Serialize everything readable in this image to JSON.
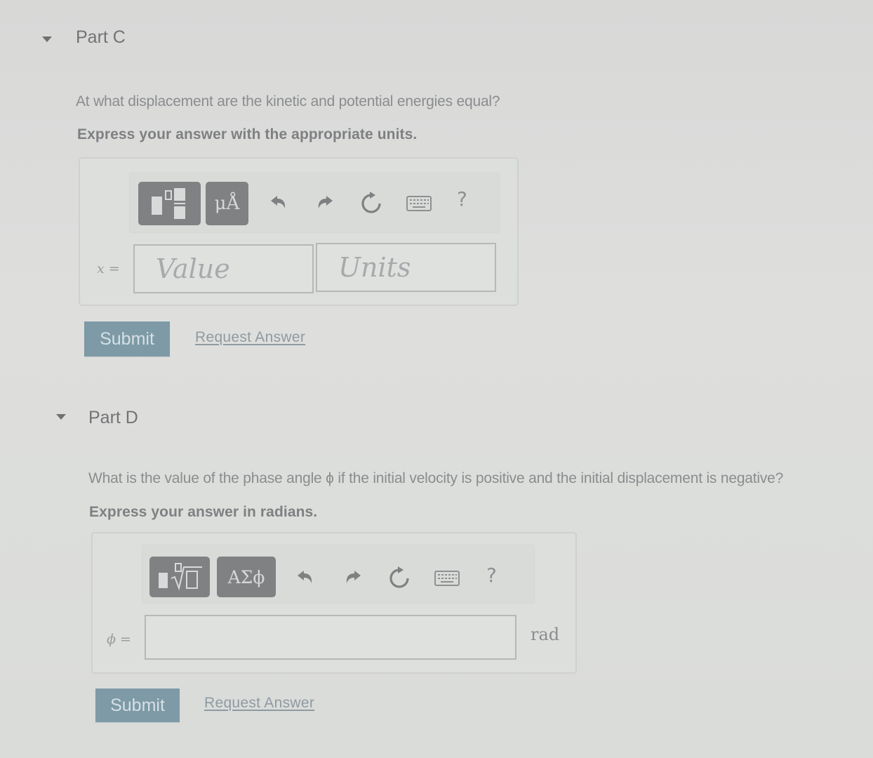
{
  "part_c": {
    "title": "Part C",
    "question": "At what displacement are the kinetic and potential energies equal?",
    "instruction": "Express your answer with the appropriate units.",
    "toolbar": {
      "template_button": "templates-icon",
      "units_button_label": "μÅ",
      "undo": "undo-icon",
      "redo": "redo-icon",
      "reset": "reset-icon",
      "keyboard": "keyboard-icon",
      "help_label": "?"
    },
    "variable_label": "x =",
    "value_placeholder": "Value",
    "units_placeholder": "Units",
    "submit_label": "Submit",
    "request_answer_label": "Request Answer"
  },
  "part_d": {
    "title": "Part D",
    "question": "What is the value of the phase angle ϕ if the initial velocity is positive and the initial displacement is negative?",
    "instruction": "Express your answer in radians.",
    "toolbar": {
      "template_button": "templates-root-icon",
      "symbols_button_label": "ΑΣϕ",
      "undo": "undo-icon",
      "redo": "redo-icon",
      "reset": "reset-icon",
      "keyboard": "keyboard-icon",
      "help_label": "?"
    },
    "variable_label": "ϕ =",
    "answer_value": "",
    "unit_label": "rad",
    "submit_label": "Submit",
    "request_answer_label": "Request Answer"
  },
  "colors": {
    "submit_button": "#7d9aa6",
    "toolbar_button": "#7f8183",
    "background": "#dcdcdb"
  }
}
